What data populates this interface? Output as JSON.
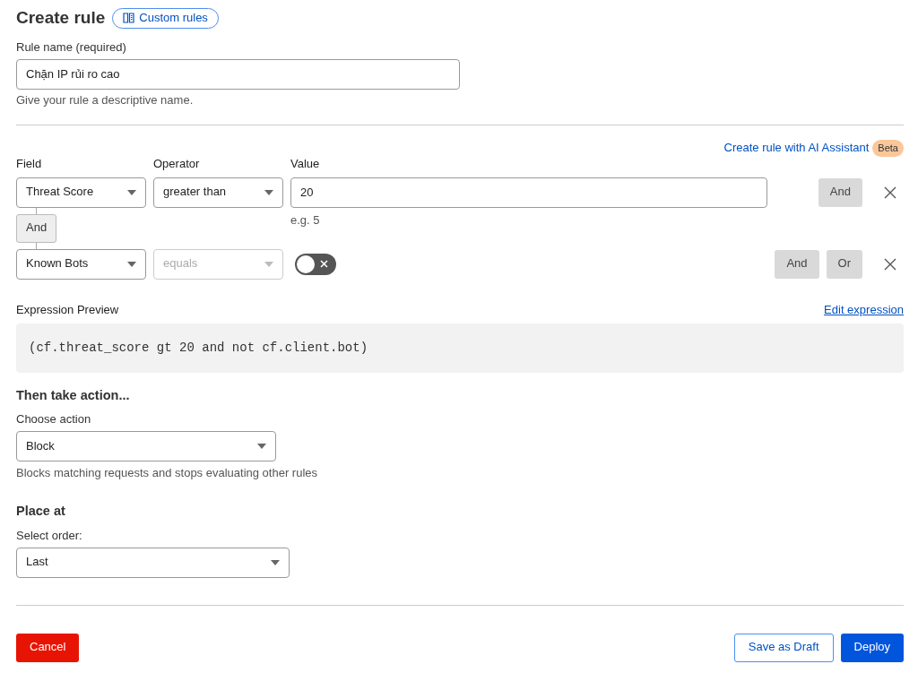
{
  "header": {
    "title": "Create rule",
    "link": "Custom rules"
  },
  "rule_name": {
    "label": "Rule name (required)",
    "value": "Chặn IP rủi ro cao",
    "help": "Give your rule a descriptive name."
  },
  "ai_link": {
    "label": "Create rule with AI Assistant",
    "badge": "Beta"
  },
  "columns": {
    "field": "Field",
    "operator": "Operator",
    "value": "Value"
  },
  "conditions": [
    {
      "kind": "text",
      "field": "Threat Score",
      "operator": "greater than",
      "operator_disabled": false,
      "value": "20",
      "hint": "e.g. 5",
      "buttons": [
        "And"
      ]
    },
    {
      "kind": "toggle",
      "field": "Known Bots",
      "operator": "equals",
      "operator_disabled": true,
      "on": false,
      "buttons": [
        "And",
        "Or"
      ]
    }
  ],
  "joiner": "And",
  "expression": {
    "label": "Expression Preview",
    "edit_link": "Edit expression",
    "code": "(cf.threat_score gt 20 and not cf.client.bot)"
  },
  "action": {
    "heading": "Then take action...",
    "label": "Choose action",
    "value": "Block",
    "help": "Blocks matching requests and stops evaluating other rules"
  },
  "place": {
    "heading": "Place at",
    "label": "Select order:",
    "value": "Last"
  },
  "footer": {
    "cancel": "Cancel",
    "buttons": [
      "Save as Draft",
      "Deploy"
    ]
  }
}
